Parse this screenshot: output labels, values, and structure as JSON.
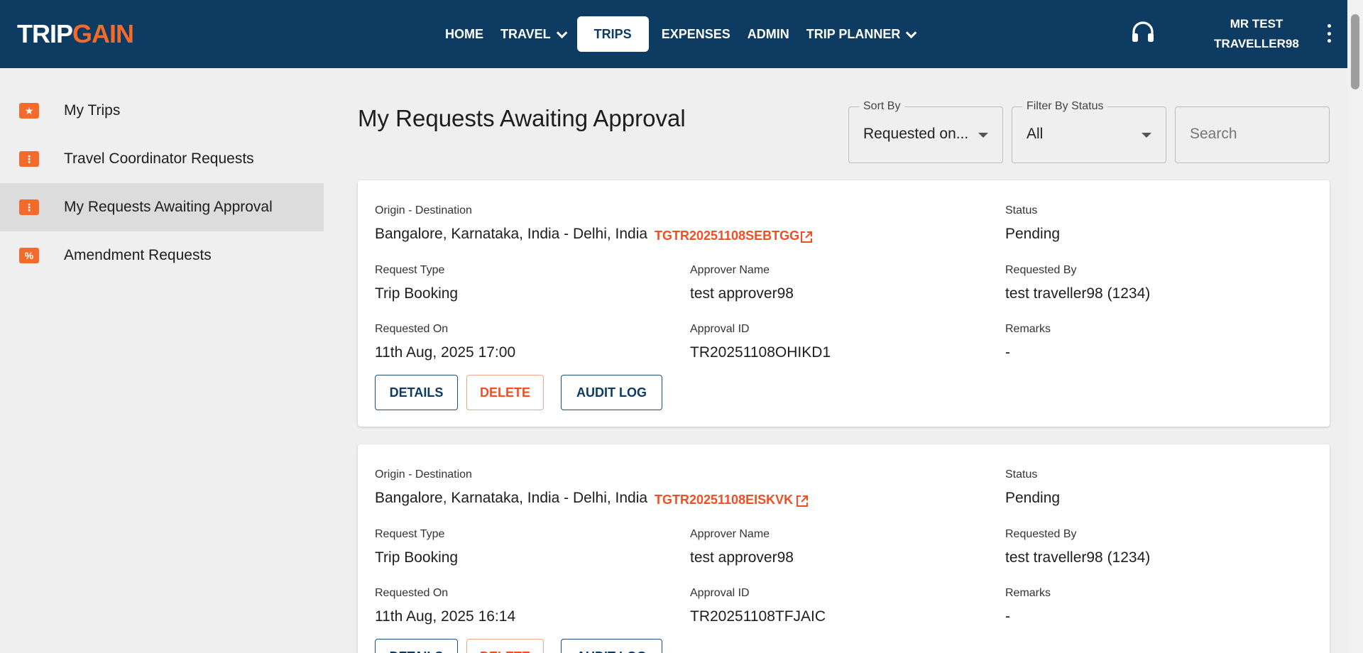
{
  "header": {
    "logo_trip": "TRIP",
    "logo_gain": "GAIN",
    "nav": [
      {
        "label": "HOME",
        "dropdown": false,
        "active": false
      },
      {
        "label": "TRAVEL",
        "dropdown": true,
        "active": false
      },
      {
        "label": "TRIPS",
        "dropdown": false,
        "active": true
      },
      {
        "label": "EXPENSES",
        "dropdown": false,
        "active": false
      },
      {
        "label": "ADMIN",
        "dropdown": false,
        "active": false
      },
      {
        "label": "TRIP PLANNER",
        "dropdown": true,
        "active": false
      }
    ],
    "user_line1": "MR TEST",
    "user_line2": "TRAVELLER98",
    "colors": {
      "bg": "#0e3b62",
      "accent": "#f26b2b"
    }
  },
  "sidebar": {
    "items": [
      {
        "label": "My Trips",
        "icon": "ticket-star-icon",
        "active": false
      },
      {
        "label": "Travel Coordinator Requests",
        "icon": "ticket-icon",
        "active": false
      },
      {
        "label": "My Requests Awaiting Approval",
        "icon": "ticket-icon",
        "active": true
      },
      {
        "label": "Amendment Requests",
        "icon": "ticket-percent-icon",
        "active": false
      }
    ]
  },
  "main": {
    "title": "My Requests Awaiting Approval",
    "sort": {
      "legend": "Sort By",
      "value": "Requested on..."
    },
    "filter": {
      "legend": "Filter By Status",
      "value": "All"
    },
    "search": {
      "placeholder": "Search"
    },
    "labels": {
      "origin_destination": "Origin - Destination",
      "status": "Status",
      "request_type": "Request Type",
      "approver_name": "Approver Name",
      "requested_by": "Requested By",
      "requested_on": "Requested On",
      "approval_id": "Approval ID",
      "remarks": "Remarks"
    },
    "buttons": {
      "details": "DETAILS",
      "delete": "DELETE",
      "audit_log": "AUDIT LOG"
    },
    "requests": [
      {
        "route": "Bangalore, Karnataka, India - Delhi, India",
        "trip_code": "TGTR20251108SEBTGG",
        "status": "Pending",
        "request_type": "Trip Booking",
        "approver_name": "test approver98",
        "requested_by": "test traveller98 (1234)",
        "requested_on": "11th Aug, 2025 17:00",
        "approval_id": "TR20251108OHIKD1",
        "remarks": "-"
      },
      {
        "route": "Bangalore, Karnataka, India - Delhi, India",
        "trip_code": "TGTR20251108EISKVK",
        "status": "Pending",
        "request_type": "Trip Booking",
        "approver_name": "test approver98",
        "requested_by": "test traveller98 (1234)",
        "requested_on": "11th Aug, 2025 16:14",
        "approval_id": "TR20251108TFJAIC",
        "remarks": "-"
      }
    ]
  }
}
